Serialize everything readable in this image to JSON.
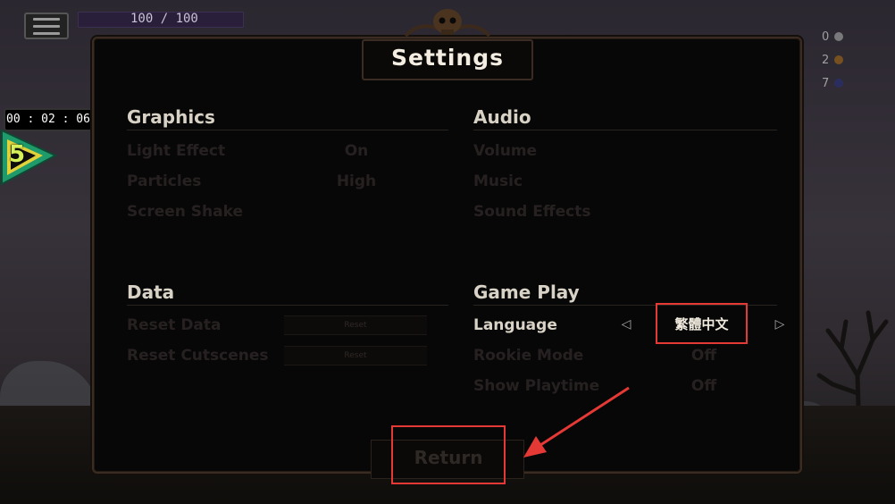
{
  "hud": {
    "hp_text": "100 / 100",
    "timer": "00 : 02 : 06",
    "level": "5",
    "resources": [
      {
        "count": "0",
        "icon": "sword-icon",
        "color": "#8c8c8c"
      },
      {
        "count": "2",
        "icon": "bag-icon",
        "color": "#8a5a1c"
      },
      {
        "count": "7",
        "icon": "gem-icon",
        "color": "#2a2f6a"
      }
    ]
  },
  "settings": {
    "title": "Settings",
    "graphics": {
      "title": "Graphics",
      "rows": [
        {
          "label": "Light Effect",
          "value": "On"
        },
        {
          "label": "Particles",
          "value": "High"
        },
        {
          "label": "Screen Shake",
          "value": ""
        }
      ]
    },
    "audio": {
      "title": "Audio",
      "rows": [
        {
          "label": "Volume"
        },
        {
          "label": "Music"
        },
        {
          "label": "Sound Effects"
        }
      ]
    },
    "data": {
      "title": "Data",
      "rows": [
        {
          "label": "Reset Data",
          "button": "Reset"
        },
        {
          "label": "Reset Cutscenes",
          "button": "Reset"
        }
      ]
    },
    "gameplay": {
      "title": "Game Play",
      "language_label": "Language",
      "language_value": "繁體中文",
      "rows": [
        {
          "label": "Rookie Mode",
          "value": "Off"
        },
        {
          "label": "Show Playtime",
          "value": "Off"
        }
      ]
    },
    "return_label": "Return"
  },
  "colors": {
    "highlight": "#e53935",
    "panel_bg": "#070707",
    "level_accent": "#d6f05a"
  }
}
